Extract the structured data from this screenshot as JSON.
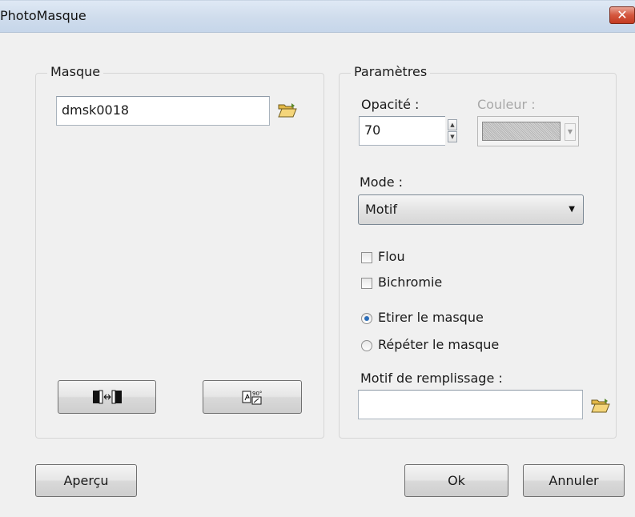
{
  "window": {
    "title": "PhotoMasque",
    "close_label": "✕"
  },
  "masque": {
    "legend": "Masque",
    "file_value": "dmsk0018",
    "flip_button_icon": "flip-horizontal-icon",
    "rotate_button_icon": "rotate-90-icon"
  },
  "parametres": {
    "legend": "Paramètres",
    "opacity_label": "Opacité :",
    "opacity_value": "70",
    "color_label": "Couleur :",
    "mode_label": "Mode :",
    "mode_value": "Motif",
    "flou_label": "Flou",
    "flou_checked": false,
    "bichromie_label": "Bichromie",
    "bichromie_checked": false,
    "etirer_label": "Etirer le masque",
    "repeter_label": "Répéter le masque",
    "selected_fit": "etirer",
    "fill_pattern_label": "Motif de remplissage :",
    "fill_pattern_value": ""
  },
  "footer": {
    "preview_label": "Aperçu",
    "ok_label": "Ok",
    "cancel_label": "Annuler"
  },
  "colors": {
    "titlebar": "#cfdcec",
    "close_button": "#d4563d",
    "radio_selected": "#2b6db8",
    "folder_icon": "#e8c25a"
  }
}
